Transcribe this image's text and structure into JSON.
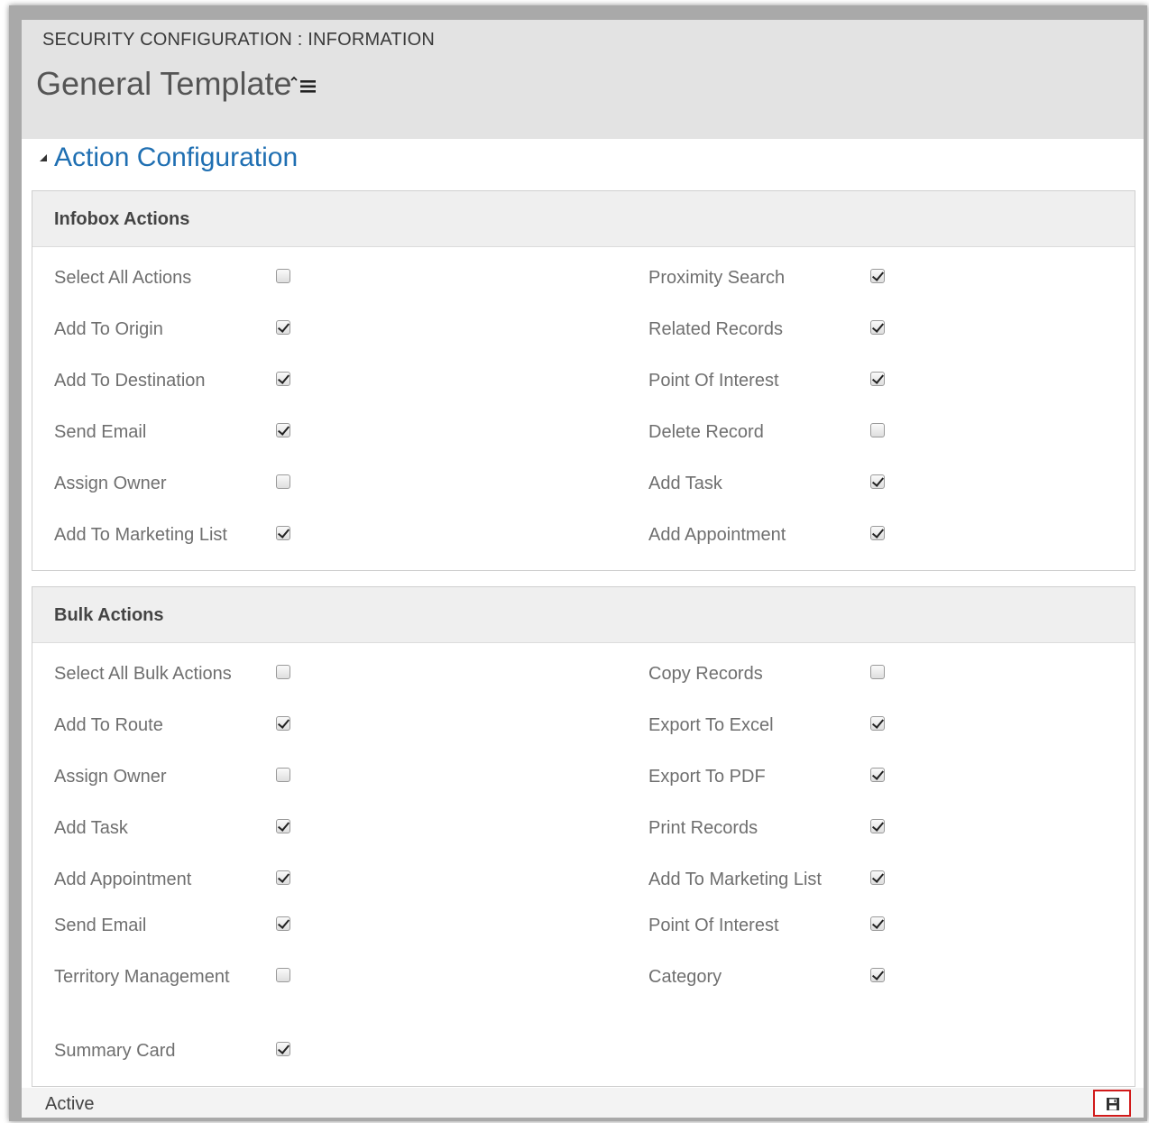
{
  "header": {
    "subtitle": "SECURITY CONFIGURATION : INFORMATION",
    "title": "General Template",
    "menu_icon": "list-menu-icon"
  },
  "section": {
    "title": "Action Configuration",
    "toggle_icon": "collapse-triangle-icon"
  },
  "infobox": {
    "title": "Infobox Actions",
    "left": [
      {
        "label": "Select All Actions",
        "checked": false
      },
      {
        "label": "Add To Origin",
        "checked": true
      },
      {
        "label": "Add To Destination",
        "checked": true
      },
      {
        "label": "Send Email",
        "checked": true
      },
      {
        "label": "Assign Owner",
        "checked": false
      },
      {
        "label": "Add To Marketing List",
        "checked": true
      }
    ],
    "right": [
      {
        "label": "Proximity Search",
        "checked": true
      },
      {
        "label": "Related Records",
        "checked": true
      },
      {
        "label": "Point Of Interest",
        "checked": true
      },
      {
        "label": "Delete Record",
        "checked": false
      },
      {
        "label": "Add Task",
        "checked": true
      },
      {
        "label": "Add Appointment",
        "checked": true
      }
    ]
  },
  "bulk": {
    "title": "Bulk Actions",
    "left": [
      {
        "label": "Select All Bulk Actions",
        "checked": false
      },
      {
        "label": "Add To Route",
        "checked": true
      },
      {
        "label": "Assign Owner",
        "checked": false
      },
      {
        "label": "Add Task",
        "checked": true
      },
      {
        "label": "Add Appointment",
        "checked": true
      },
      {
        "label": "Send Email",
        "checked": true
      },
      {
        "label": "Territory Management",
        "checked": false
      },
      {
        "label": "Summary Card",
        "checked": true
      }
    ],
    "right": [
      {
        "label": "Copy Records",
        "checked": false
      },
      {
        "label": "Export To Excel",
        "checked": true
      },
      {
        "label": "Export To PDF",
        "checked": true
      },
      {
        "label": "Print Records",
        "checked": true
      },
      {
        "label": "Add To Marketing List",
        "checked": true
      },
      {
        "label": "Point Of Interest",
        "checked": true
      },
      {
        "label": "Category",
        "checked": true
      }
    ]
  },
  "footer": {
    "status": "Active",
    "save_icon": "save-icon"
  },
  "colors": {
    "accent": "#1f6fb2",
    "highlight": "#d11a1a"
  }
}
